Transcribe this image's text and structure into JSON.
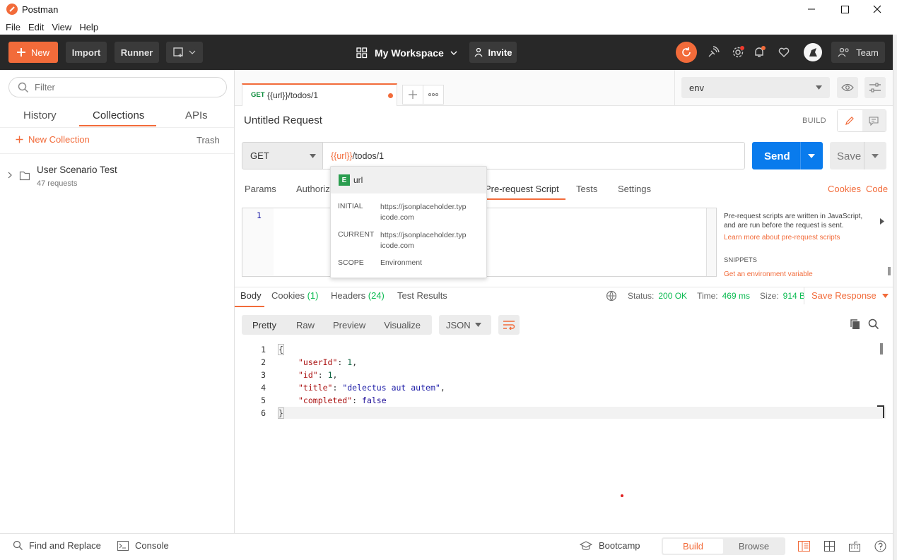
{
  "window": {
    "title": "Postman",
    "controls": [
      "minimize",
      "maximize",
      "close"
    ]
  },
  "menu": [
    "File",
    "Edit",
    "View",
    "Help"
  ],
  "header": {
    "new_label": "New",
    "import_label": "Import",
    "runner_label": "Runner",
    "workspace": "My Workspace",
    "invite_label": "Invite",
    "team_label": "Team"
  },
  "sidebar": {
    "filter_placeholder": "Filter",
    "tabs": [
      "History",
      "Collections",
      "APIs"
    ],
    "active_tab": "Collections",
    "new_collection": "New Collection",
    "trash": "Trash",
    "collections": [
      {
        "name": "User Scenario Test",
        "count": "47 requests"
      }
    ]
  },
  "request_tab": {
    "method": "GET",
    "title": "{{url}}/todos/1"
  },
  "environment": {
    "selected": "env"
  },
  "request": {
    "name": "Untitled Request",
    "mode": "BUILD",
    "method": "GET",
    "url_var": "{{url}}",
    "url_rest": "/todos/1",
    "send_label": "Send",
    "save_label": "Save",
    "tabs": [
      "Params",
      "Authoriz",
      "Pre-request Script",
      "Tests",
      "Settings"
    ],
    "active_tab": "Pre-request Script",
    "cookies_link": "Cookies",
    "code_link": "Code",
    "editor_line": "1"
  },
  "autocomplete": {
    "badge": "E",
    "var_name": "url",
    "rows": [
      {
        "label": "INITIAL",
        "line1": "https://jsonplaceholder.typ",
        "line2": "icode.com"
      },
      {
        "label": "CURRENT",
        "line1": "https://jsonplaceholder.typ",
        "line2": "icode.com"
      },
      {
        "label": "SCOPE",
        "line1": "Environment",
        "line2": ""
      }
    ]
  },
  "helper": {
    "text1": "Pre-request scripts are written in JavaScript,",
    "text2": "and are run before the request is sent.",
    "link": "Learn more about pre-request scripts",
    "snippets_title": "SNIPPETS",
    "snippet1": "Get an environment variable"
  },
  "response": {
    "tabs": {
      "body": "Body",
      "cookies": "Cookies",
      "cookies_count": "(1)",
      "headers": "Headers",
      "headers_count": "(24)",
      "tests": "Test Results"
    },
    "status_label": "Status:",
    "status_value": "200 OK",
    "time_label": "Time:",
    "time_value": "469 ms",
    "size_label": "Size:",
    "size_value": "914 B",
    "save_response": "Save Response",
    "view_modes": [
      "Pretty",
      "Raw",
      "Preview",
      "Visualize"
    ],
    "format": "JSON",
    "line_numbers": [
      "1",
      "2",
      "3",
      "4",
      "5",
      "6"
    ],
    "body": {
      "open": "{",
      "l2_key": "\"userId\"",
      "l2_val": "1",
      "l3_key": "\"id\"",
      "l3_val": "1",
      "l4_key": "\"title\"",
      "l4_val": "\"delectus aut autem\"",
      "l5_key": "\"completed\"",
      "l5_val": "false",
      "close": "}"
    }
  },
  "footer": {
    "find_replace": "Find and Replace",
    "console": "Console",
    "bootcamp": "Bootcamp",
    "build": "Build",
    "browse": "Browse"
  },
  "colors": {
    "brand_orange": "#f26b3a",
    "header_bg": "#282828",
    "send_blue": "#097bed",
    "link_orange": "#f26b3a",
    "status_green": "#0cbb52",
    "badge_green": "#2a9d4f"
  }
}
